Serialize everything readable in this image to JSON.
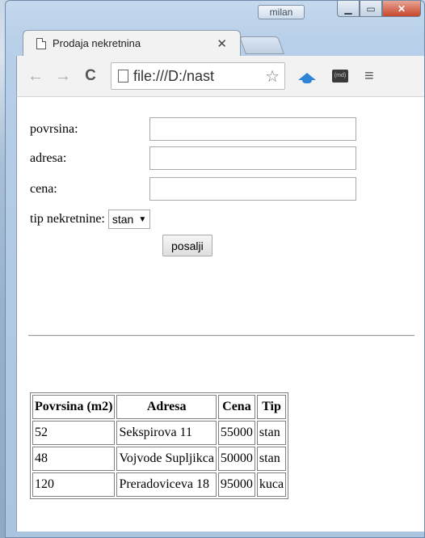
{
  "browser": {
    "profile_name": "milan",
    "tab_title": "Prodaja nekretnina",
    "tab_close": "✕",
    "address": "file:///D:/nast"
  },
  "form": {
    "fields": [
      {
        "label": "povrsina:",
        "value": ""
      },
      {
        "label": "adresa:",
        "value": ""
      },
      {
        "label": "cena:",
        "value": ""
      }
    ],
    "type_label": "tip nekretnine:",
    "type_selected": "stan",
    "submit_label": "posalji"
  },
  "table": {
    "headers": [
      "Povrsina (m2)",
      "Adresa",
      "Cena",
      "Tip"
    ],
    "rows": [
      [
        "52",
        "Sekspirova 11",
        "55000",
        "stan"
      ],
      [
        "48",
        "Vojvode Supljikca",
        "50000",
        "stan"
      ],
      [
        "120",
        "Preradoviceva 18",
        "95000",
        "kuca"
      ]
    ]
  },
  "icons": {
    "back": "back-arrow-icon",
    "forward": "forward-arrow-icon",
    "reload": "reload-icon",
    "star": "bookmark-star-icon",
    "menu": "hamburger-menu-icon"
  }
}
